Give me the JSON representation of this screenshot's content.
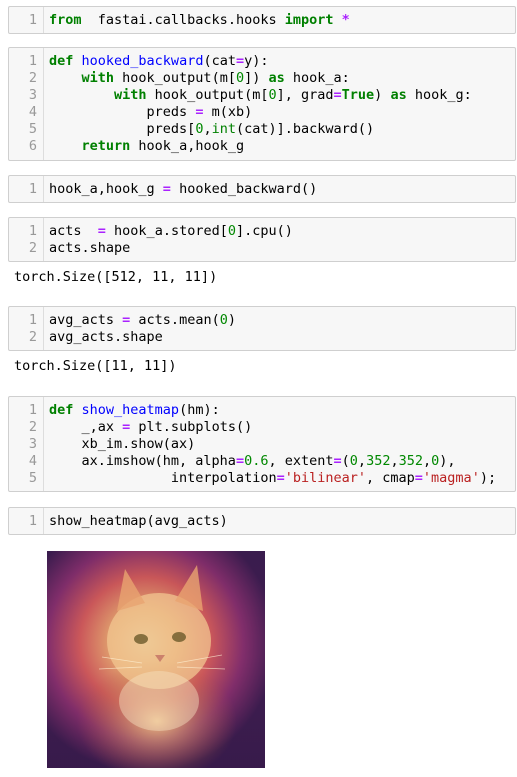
{
  "cells": [
    {
      "lines": [
        {
          "n": "1",
          "toks": [
            [
              "k",
              "from"
            ],
            [
              "",
              "  fastai.callbacks.hooks "
            ],
            [
              "k",
              "import"
            ],
            [
              "",
              " "
            ],
            [
              "o",
              "*"
            ]
          ]
        }
      ]
    },
    {
      "lines": [
        {
          "n": "1",
          "toks": [
            [
              "k",
              "def"
            ],
            [
              "",
              " "
            ],
            [
              "f",
              "hooked_backward"
            ],
            [
              "",
              "(cat"
            ],
            [
              "o",
              "="
            ],
            [
              "",
              "y):"
            ]
          ]
        },
        {
          "n": "2",
          "toks": [
            [
              "",
              "    "
            ],
            [
              "k",
              "with"
            ],
            [
              "",
              " hook_output(m["
            ],
            [
              "n",
              "0"
            ],
            [
              "",
              "]) "
            ],
            [
              "k",
              "as"
            ],
            [
              "",
              " hook_a:"
            ]
          ]
        },
        {
          "n": "3",
          "toks": [
            [
              "",
              "        "
            ],
            [
              "k",
              "with"
            ],
            [
              "",
              " hook_output(m["
            ],
            [
              "n",
              "0"
            ],
            [
              "",
              "], grad"
            ],
            [
              "o",
              "="
            ],
            [
              "k",
              "True"
            ],
            [
              "",
              ") "
            ],
            [
              "k",
              "as"
            ],
            [
              "",
              " hook_g:"
            ]
          ]
        },
        {
          "n": "4",
          "toks": [
            [
              "",
              "            preds "
            ],
            [
              "o",
              "="
            ],
            [
              "",
              " m(xb)"
            ]
          ]
        },
        {
          "n": "5",
          "toks": [
            [
              "",
              "            preds["
            ],
            [
              "n",
              "0"
            ],
            [
              "",
              ","
            ],
            [
              "b",
              "int"
            ],
            [
              "",
              "(cat)].backward()"
            ]
          ]
        },
        {
          "n": "6",
          "toks": [
            [
              "",
              "    "
            ],
            [
              "k",
              "return"
            ],
            [
              "",
              " hook_a,hook_g"
            ]
          ]
        }
      ]
    },
    {
      "lines": [
        {
          "n": "1",
          "toks": [
            [
              "",
              "hook_a,hook_g "
            ],
            [
              "o",
              "="
            ],
            [
              "",
              " hooked_backward()"
            ]
          ]
        }
      ]
    },
    {
      "lines": [
        {
          "n": "1",
          "toks": [
            [
              "",
              "acts  "
            ],
            [
              "o",
              "="
            ],
            [
              "",
              " hook_a.stored["
            ],
            [
              "n",
              "0"
            ],
            [
              "",
              "].cpu()"
            ]
          ]
        },
        {
          "n": "2",
          "toks": [
            [
              "",
              "acts.shape"
            ]
          ]
        }
      ]
    },
    {
      "lines": [
        {
          "n": "1",
          "toks": [
            [
              "",
              "avg_acts "
            ],
            [
              "o",
              "="
            ],
            [
              "",
              " acts.mean("
            ],
            [
              "n",
              "0"
            ],
            [
              "",
              ")"
            ]
          ]
        },
        {
          "n": "2",
          "toks": [
            [
              "",
              "avg_acts.shape"
            ]
          ]
        }
      ]
    },
    {
      "lines": [
        {
          "n": "1",
          "toks": [
            [
              "k",
              "def"
            ],
            [
              "",
              " "
            ],
            [
              "f",
              "show_heatmap"
            ],
            [
              "",
              "(hm):"
            ]
          ]
        },
        {
          "n": "2",
          "toks": [
            [
              "",
              "    _,ax "
            ],
            [
              "o",
              "="
            ],
            [
              "",
              " plt.subplots()"
            ]
          ]
        },
        {
          "n": "3",
          "toks": [
            [
              "",
              "    xb_im.show(ax)"
            ]
          ]
        },
        {
          "n": "4",
          "toks": [
            [
              "",
              "    ax.imshow(hm, alpha"
            ],
            [
              "o",
              "="
            ],
            [
              "n",
              "0.6"
            ],
            [
              "",
              ", extent"
            ],
            [
              "o",
              "="
            ],
            [
              "",
              "("
            ],
            [
              "n",
              "0"
            ],
            [
              "",
              ","
            ],
            [
              "n",
              "352"
            ],
            [
              "",
              ","
            ],
            [
              "n",
              "352"
            ],
            [
              "",
              ","
            ],
            [
              "n",
              "0"
            ],
            [
              "",
              "),"
            ]
          ]
        },
        {
          "n": "5",
          "toks": [
            [
              "",
              "               interpolation"
            ],
            [
              "o",
              "="
            ],
            [
              "s",
              "'bilinear'"
            ],
            [
              "",
              ", cmap"
            ],
            [
              "o",
              "="
            ],
            [
              "s",
              "'magma'"
            ],
            [
              "",
              ");"
            ]
          ]
        }
      ]
    },
    {
      "lines": [
        {
          "n": "1",
          "toks": [
            [
              "",
              "show_heatmap(avg_acts)"
            ]
          ]
        }
      ]
    }
  ],
  "outputs": {
    "acts_shape": "torch.Size([512, 11, 11])",
    "avg_shape": "torch.Size([11, 11])"
  },
  "colors": {
    "keyword": "#008000",
    "operator": "#aa22ff",
    "function_name": "#0000ff",
    "number": "#008800",
    "string": "#ba2121"
  }
}
